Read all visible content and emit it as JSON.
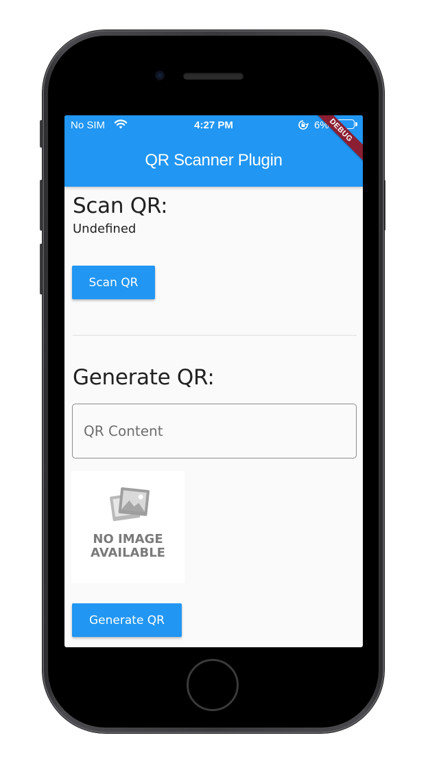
{
  "status_bar": {
    "carrier": "No SIM",
    "time": "4:27 PM",
    "battery": "6%"
  },
  "app_bar": {
    "title": "QR Scanner Plugin",
    "debug_banner": "DEBUG"
  },
  "scan_section": {
    "title": "Scan QR:",
    "result": "Undefined",
    "button_label": "Scan QR"
  },
  "generate_section": {
    "title": "Generate QR:",
    "input_placeholder": "QR Content",
    "input_value": "",
    "placeholder_image": {
      "line1": "NO IMAGE",
      "line2": "AVAILABLE"
    },
    "button_label": "Generate QR"
  },
  "colors": {
    "primary": "#2196f3",
    "background": "#fafafa",
    "debug_banner": "#8b1e32"
  },
  "icons": {
    "wifi": "wifi-icon",
    "orientation_lock": "orientation-lock-icon",
    "battery": "battery-icon",
    "no_image": "image-placeholder-icon"
  }
}
